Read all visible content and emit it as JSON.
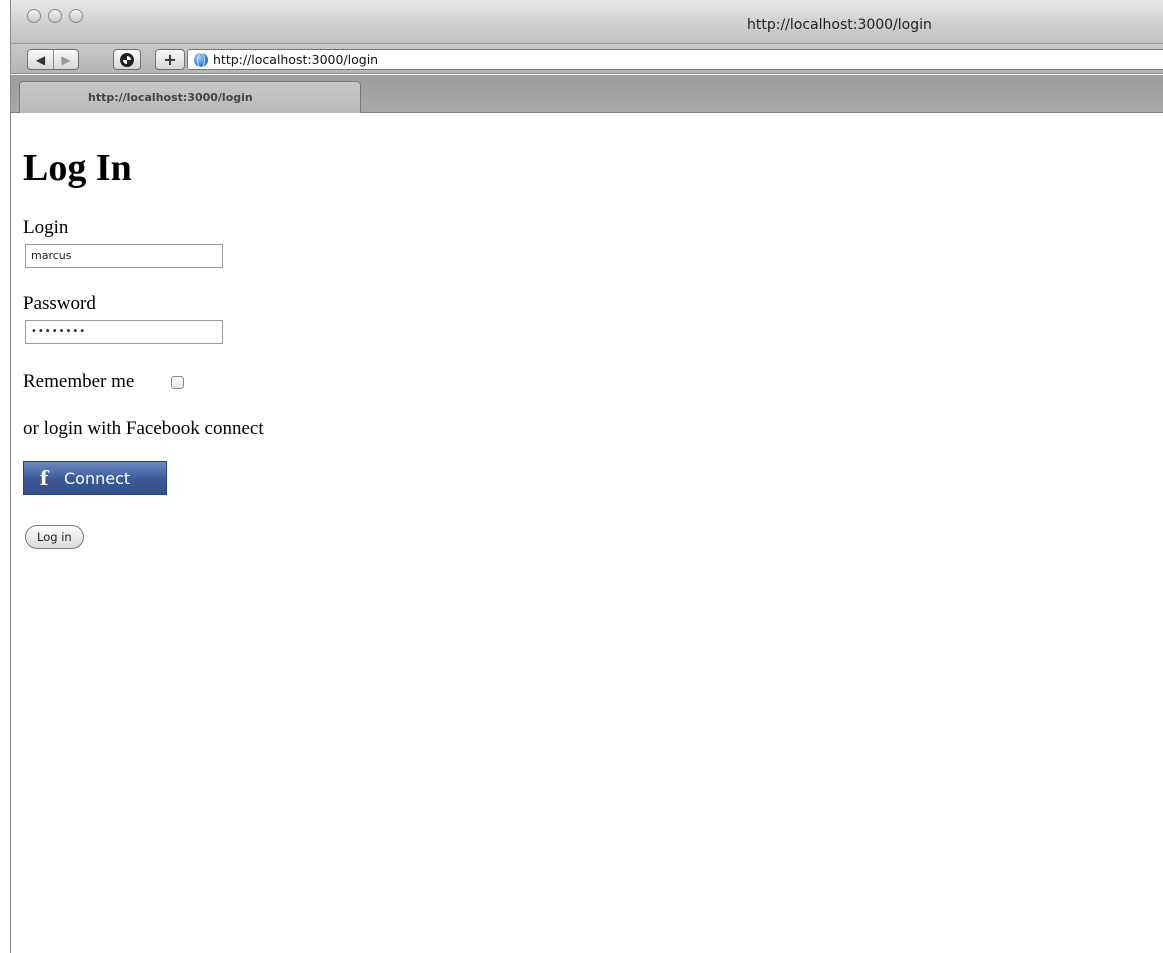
{
  "window": {
    "title": "http://localhost:3000/login"
  },
  "toolbar": {
    "back_icon": "◀",
    "forward_icon": "▶",
    "add_label": "+",
    "url": "http://localhost:3000/login"
  },
  "tab": {
    "label": "http://localhost:3000/login"
  },
  "page": {
    "heading": "Log In",
    "login_label": "Login",
    "login_value": "marcus",
    "password_label": "Password",
    "password_value": "••••••••",
    "remember_label": "Remember me",
    "facebook_text": "or login with Facebook connect",
    "facebook_icon": "f",
    "facebook_button": "Connect",
    "login_button": "Log in"
  },
  "colors": {
    "facebook_blue": "#3b5998",
    "titlebar": "#cfcfcf"
  }
}
